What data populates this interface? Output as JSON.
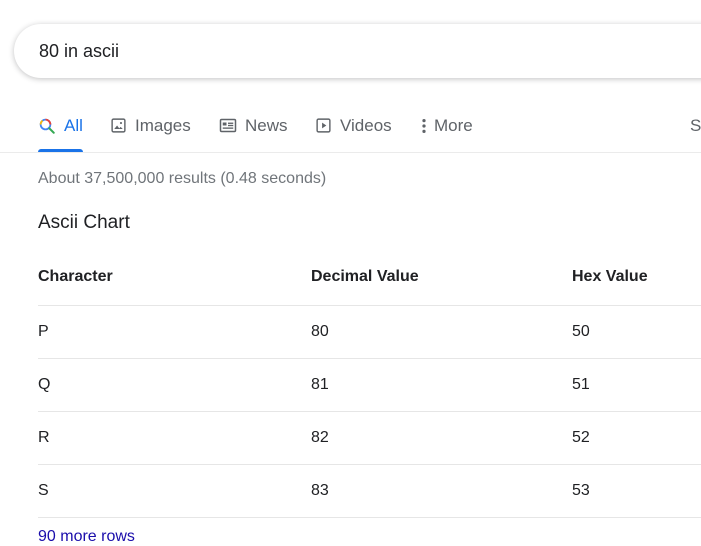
{
  "search": {
    "query": "80 in ascii"
  },
  "tabs": [
    {
      "label": "All",
      "icon": "search-icon",
      "active": true
    },
    {
      "label": "Images",
      "icon": "image-icon"
    },
    {
      "label": "News",
      "icon": "news-icon"
    },
    {
      "label": "Videos",
      "icon": "video-icon"
    },
    {
      "label": "More",
      "icon": "more-vert-icon"
    },
    {
      "label": "Se"
    }
  ],
  "result_stats": "About 37,500,000 results (0.48 seconds)",
  "featured": {
    "title": "Ascii Chart",
    "headers": [
      "Character",
      "Decimal Value",
      "Hex Value"
    ],
    "rows": [
      [
        "P",
        "80",
        "50"
      ],
      [
        "Q",
        "81",
        "51"
      ],
      [
        "R",
        "82",
        "52"
      ],
      [
        "S",
        "83",
        "53"
      ]
    ],
    "more_rows": "90 more rows"
  },
  "colors": {
    "accent": "#1a73e8",
    "link": "#1a0dab",
    "muted": "#70757a"
  }
}
